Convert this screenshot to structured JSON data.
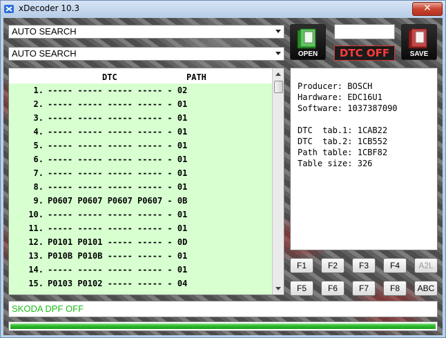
{
  "window": {
    "title": "xDecoder 10.3",
    "close_glyph": "✕"
  },
  "selectors": [
    {
      "value": "AUTO SEARCH"
    },
    {
      "value": "AUTO SEARCH"
    }
  ],
  "buttons": {
    "open_label": "OPEN",
    "save_label": "SAVE",
    "dtc_off_label": "DTC OFF"
  },
  "list": {
    "headers": {
      "dtc": "DTC",
      "path": "PATH"
    },
    "rows": [
      {
        "num": "1.",
        "dtc": "----- ----- ----- -----",
        "path": "02"
      },
      {
        "num": "2.",
        "dtc": "----- ----- ----- -----",
        "path": "01"
      },
      {
        "num": "3.",
        "dtc": "----- ----- ----- -----",
        "path": "01"
      },
      {
        "num": "4.",
        "dtc": "----- ----- ----- -----",
        "path": "01"
      },
      {
        "num": "5.",
        "dtc": "----- ----- ----- -----",
        "path": "01"
      },
      {
        "num": "6.",
        "dtc": "----- ----- ----- -----",
        "path": "01"
      },
      {
        "num": "7.",
        "dtc": "----- ----- ----- -----",
        "path": "01"
      },
      {
        "num": "8.",
        "dtc": "----- ----- ----- -----",
        "path": "01"
      },
      {
        "num": "9.",
        "dtc": "P0607 P0607 P0607 P0607",
        "path": "0B"
      },
      {
        "num": "10.",
        "dtc": "----- ----- ----- -----",
        "path": "01"
      },
      {
        "num": "11.",
        "dtc": "----- ----- ----- -----",
        "path": "01"
      },
      {
        "num": "12.",
        "dtc": "P0101 P0101 ----- -----",
        "path": "0D"
      },
      {
        "num": "13.",
        "dtc": "P010B P010B ----- -----",
        "path": "01"
      },
      {
        "num": "14.",
        "dtc": "----- ----- ----- -----",
        "path": "01"
      },
      {
        "num": "15.",
        "dtc": "P0103 P0102 ----- -----",
        "path": "04"
      }
    ]
  },
  "info": {
    "producer_label": "Producer:",
    "producer": "BOSCH",
    "hardware_label": "Hardware:",
    "hardware": "EDC16U1",
    "software_label": "Software:",
    "software": "1037387090",
    "dtc_tab1_label": "DTC  tab.1:",
    "dtc_tab1": "1CAB22",
    "dtc_tab2_label": "DTC  tab.2:",
    "dtc_tab2": "1CB552",
    "path_table_label": "Path table:",
    "path_table": "1CBF82",
    "table_size_label": "Table size:",
    "table_size": "326"
  },
  "function_keys": {
    "row1": [
      "F1",
      "F2",
      "F3",
      "F4",
      "A2L"
    ],
    "row2": [
      "F5",
      "F6",
      "F7",
      "F8",
      "ABC"
    ]
  },
  "status_text": "SKODA DPF OFF",
  "progress": {
    "value": 1.0
  },
  "colors": {
    "list_bg": "#d7ffd0",
    "status_text": "#1bbd16",
    "dtc_off": "#ff3b3b",
    "progress": "#28b52a"
  }
}
